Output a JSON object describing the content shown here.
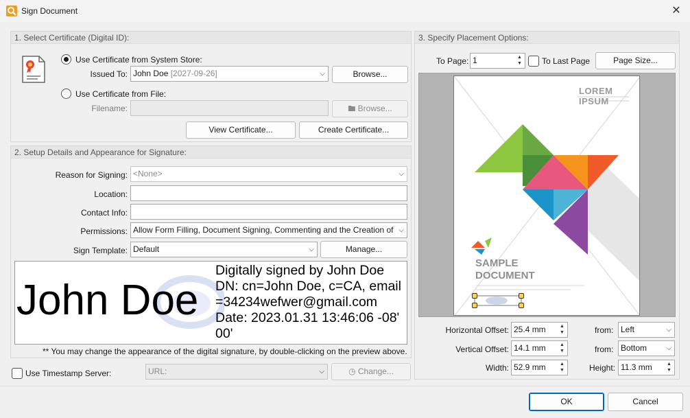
{
  "window": {
    "title": "Sign Document",
    "close_glyph": "✕"
  },
  "section1": {
    "header": "1. Select Certificate (Digital ID):",
    "radio_store_label": "Use Certificate from System Store:",
    "issued_to_label": "Issued To:",
    "issued_to_name": "John Doe",
    "issued_to_date": "[2027-09-26]",
    "browse_label": "Browse...",
    "radio_file_label": "Use Certificate from File:",
    "filename_label": "Filename:",
    "filename_value": "",
    "browse_file_label": "Browse...",
    "view_cert_label": "View Certificate...",
    "create_cert_label": "Create Certificate..."
  },
  "section2": {
    "header": "2. Setup Details and Appearance for Signature:",
    "reason_label": "Reason for Signing:",
    "reason_value": "<None>",
    "location_label": "Location:",
    "location_value": "",
    "contact_label": "Contact Info:",
    "contact_value": "",
    "permissions_label": "Permissions:",
    "permissions_value": "Allow Form Filling, Document Signing, Commenting and the Creation of",
    "template_label": "Sign Template:",
    "template_value": "Default",
    "manage_label": "Manage...",
    "preview_name": "John Doe",
    "preview_lines": [
      "Digitally signed by John Doe",
      "DN: cn=John Doe, c=CA, email",
      "=34234wefwer@gmail.com",
      "Date: 2023.01.31 13:46:06 -08'",
      "00'"
    ],
    "note": "** You may change the appearance of the digital signature, by double-clicking on the preview above."
  },
  "timestamp": {
    "checkbox_label": "Use Timestamp Server:",
    "url_placeholder": "URL:",
    "change_label": "Change..."
  },
  "section3": {
    "header": "3. Specify Placement Options:",
    "to_page_label": "To Page:",
    "to_page_value": "1",
    "to_last_page_label": "To Last Page",
    "page_size_label": "Page Size...",
    "preview_title": "LOREM IPSUM",
    "preview_sample_1": "SAMPLE",
    "preview_sample_2": "DOCUMENT",
    "h_offset_label": "Horizontal Offset:",
    "h_offset_value": "25.4 mm",
    "h_from_label": "from:",
    "h_from_value": "Left",
    "v_offset_label": "Vertical Offset:",
    "v_offset_value": "14.1 mm",
    "v_from_label": "from:",
    "v_from_value": "Bottom",
    "width_label": "Width:",
    "width_value": "52.9 mm",
    "height_label": "Height:",
    "height_value": "11.3 mm"
  },
  "footer": {
    "ok_label": "OK",
    "cancel_label": "Cancel"
  },
  "colors": {
    "accent": "#0067c0",
    "triangle_green": "#8dc63f",
    "triangle_darkgreen": "#4c8f3a",
    "triangle_pink": "#e8577d",
    "triangle_orange": "#f7941d",
    "triangle_red": "#f15a29",
    "triangle_blue": "#1b95c9",
    "triangle_purple": "#8b4aa0"
  }
}
